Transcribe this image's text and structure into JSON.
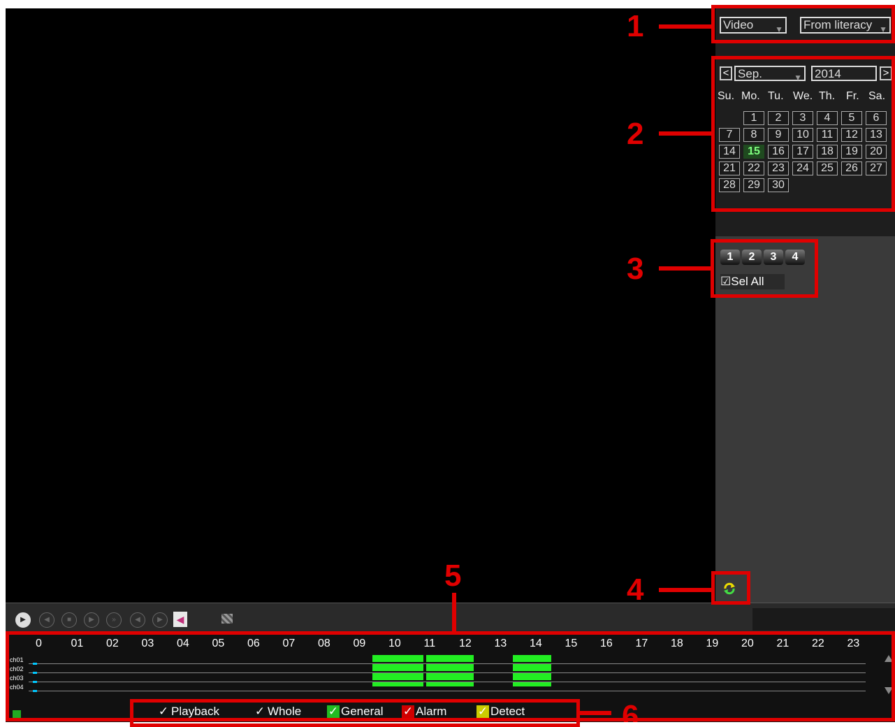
{
  "top": {
    "type_select": "Video",
    "source_select": "From literacy"
  },
  "calendar": {
    "prev": "<",
    "next": ">",
    "month": "Sep.",
    "year": "2014",
    "weekdays": [
      "Su.",
      "Mo.",
      "Tu.",
      "We.",
      "Th.",
      "Fr.",
      "Sa."
    ],
    "days": [
      "1",
      "2",
      "3",
      "4",
      "5",
      "6",
      "7",
      "8",
      "9",
      "10",
      "11",
      "12",
      "13",
      "14",
      "15",
      "16",
      "17",
      "18",
      "19",
      "20",
      "21",
      "22",
      "23",
      "24",
      "25",
      "26",
      "27",
      "28",
      "29",
      "30"
    ],
    "selected_day": "15"
  },
  "channels": {
    "buttons": [
      "1",
      "2",
      "3",
      "4"
    ],
    "select_all": "Sel All"
  },
  "timeline": {
    "hours": [
      "0",
      "01",
      "02",
      "03",
      "04",
      "05",
      "06",
      "07",
      "08",
      "09",
      "10",
      "11",
      "12",
      "13",
      "14",
      "15",
      "16",
      "17",
      "18",
      "19",
      "20",
      "21",
      "22",
      "23"
    ],
    "channels": [
      "ch01",
      "ch02",
      "ch03",
      "ch04"
    ]
  },
  "filters": {
    "playback": "Playback",
    "whole": "Whole",
    "general": "General",
    "alarm": "Alarm",
    "detect": "Detect",
    "check": "✓"
  },
  "annotations": [
    "1",
    "2",
    "3",
    "4",
    "5",
    "6"
  ],
  "colors": {
    "annotation_red": "#e00000",
    "record_green": "#22ee22",
    "general_green": "#22bb22",
    "alarm_red": "#d00000",
    "detect_yellow": "#cccc00"
  }
}
